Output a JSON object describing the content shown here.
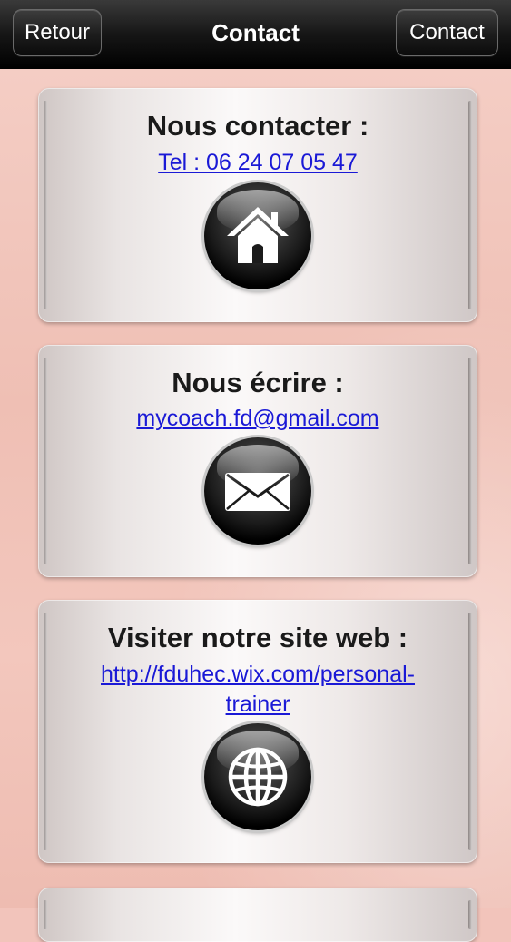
{
  "navbar": {
    "back_label": "Retour",
    "title": "Contact",
    "right_label": "Contact"
  },
  "cards": [
    {
      "title": "Nous contacter :",
      "link": "Tel : 06 24 07 05 47",
      "icon": "home-icon"
    },
    {
      "title": "Nous écrire :",
      "link": "mycoach.fd@gmail.com",
      "icon": "mail-icon"
    },
    {
      "title": "Visiter notre site web :",
      "link_line1": "http://fduhec.wix.com/personal-",
      "link_line2": "trainer",
      "icon": "globe-icon"
    }
  ],
  "colors": {
    "background": "#f2c4bb",
    "navbar": "#000000",
    "link": "#1a19d6"
  }
}
